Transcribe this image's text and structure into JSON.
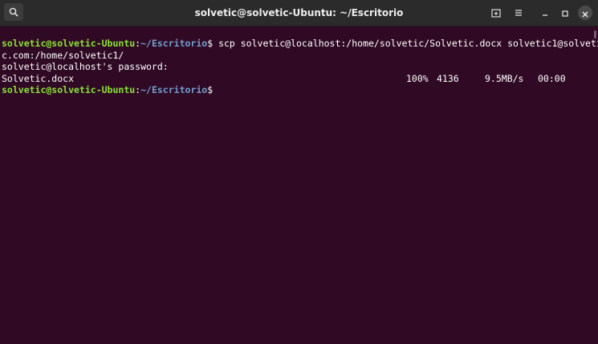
{
  "window": {
    "title": "solvetic@solvetic-Ubuntu: ~/Escritorio"
  },
  "icons": {
    "search": "search-icon",
    "new_tab": "new-tab-icon",
    "menu": "hamburger-menu-icon",
    "minimize": "minimize-icon",
    "maximize": "maximize-icon",
    "close": "close-icon"
  },
  "terminal": {
    "prompt_user": "solvetic@solvetic-Ubuntu",
    "prompt_colon": ":",
    "prompt_path": "~/Escritorio",
    "prompt_symbol": "$",
    "command_part1": " scp solvetic@localhost:/home/solvetic/Solvetic.docx solvetic1@solveti",
    "command_part2": "c.com:/home/solvetic1/",
    "password_prompt": "solvetic@localhost's password:",
    "transfer": {
      "file": "Solvetic.docx",
      "percent": "100%",
      "size": "4136",
      "rate": "9.5MB/s",
      "time": "00:00"
    }
  },
  "colors": {
    "background": "#300a24",
    "user": "#8ae234",
    "path": "#729fcf",
    "text": "#ffffff",
    "titlebar": "#2b2b2b"
  }
}
